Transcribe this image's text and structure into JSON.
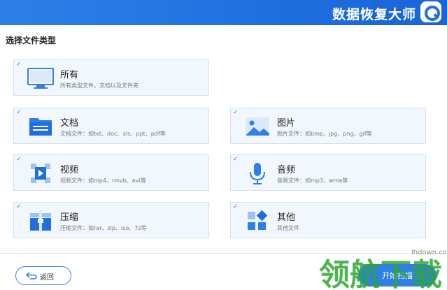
{
  "header": {
    "brand_title": "数据恢复大师"
  },
  "section": {
    "title": "选择文件类型"
  },
  "file_types": [
    {
      "title": "所有",
      "desc": "所有类型文件，文档以及文件夹",
      "checked": true
    },
    {
      "title": "文档",
      "desc": "文档文件：如txt、doc、xls、ppt、pdf等",
      "checked": true
    },
    {
      "title": "图片",
      "desc": "图片文件：如bmp、jpg、png、gif等",
      "checked": true
    },
    {
      "title": "视频",
      "desc": "视频文件：如mp4、rmvb、avi等",
      "checked": true
    },
    {
      "title": "音频",
      "desc": "音频文件：如mp3、wma等",
      "checked": true
    },
    {
      "title": "压缩",
      "desc": "压缩文件：如rar、zip、iso、7z等",
      "checked": true
    },
    {
      "title": "其他",
      "desc": "其他文件",
      "checked": true
    }
  ],
  "footer": {
    "back_label": "返回",
    "scan_label": "开始扫描"
  },
  "watermark": {
    "text": "领航下载",
    "url": "lhdown.com"
  },
  "colors": {
    "accent": "#2f7fe8",
    "card_bg": "#f2f7fd",
    "card_border": "#cfe0f3",
    "watermark_green": "#2fa832"
  }
}
